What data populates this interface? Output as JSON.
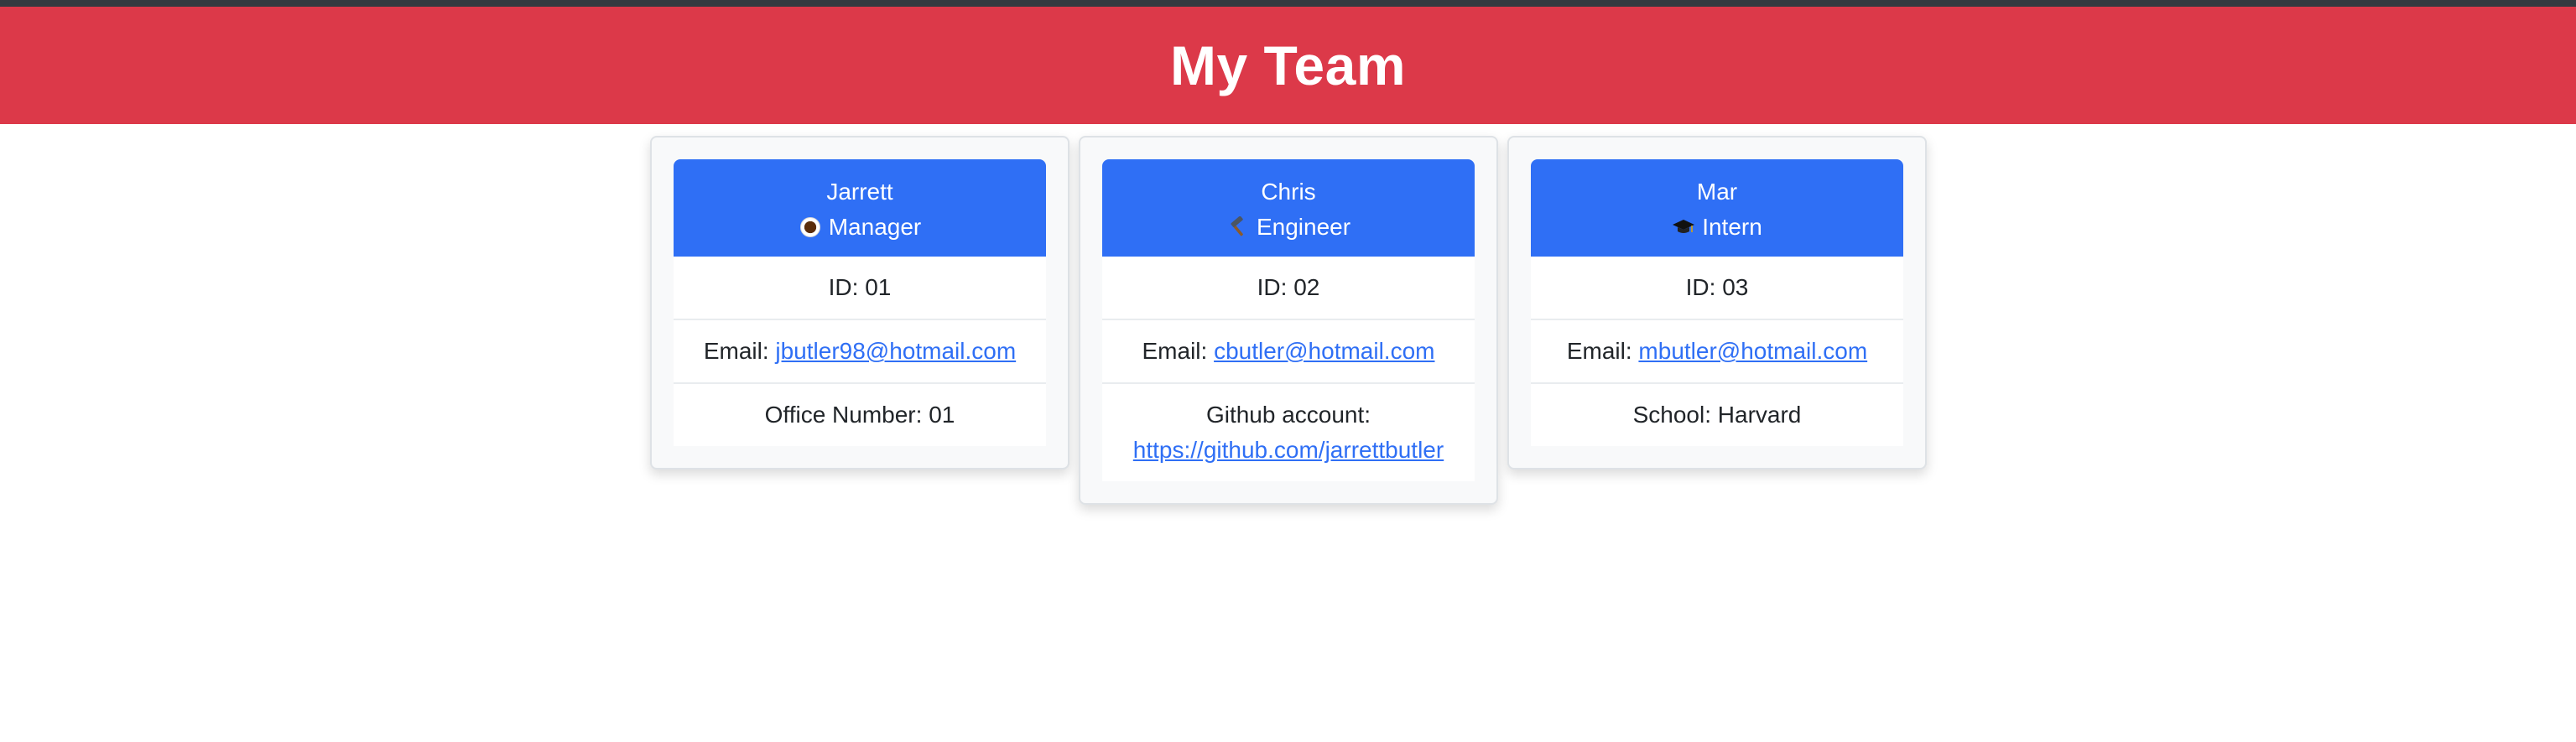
{
  "header": {
    "title": "My Team"
  },
  "team": [
    {
      "name": "Jarrett",
      "role_icon": "coffee-icon",
      "role": "Manager",
      "id": "ID: 01",
      "email_label": "Email: ",
      "email": "jbutler98@hotmail.com",
      "extra_label": "Office Number: 01",
      "extra_link": ""
    },
    {
      "name": "Chris",
      "role_icon": "hammer-icon",
      "role": "Engineer",
      "id": "ID: 02",
      "email_label": "Email: ",
      "email": "cbutler@hotmail.com",
      "extra_label": "Github account:",
      "extra_link": "https://github.com/jarrettbutler"
    },
    {
      "name": "Mar",
      "role_icon": "graduation-cap-icon",
      "role": "Intern",
      "id": "ID: 03",
      "email_label": "Email: ",
      "email": "mbutler@hotmail.com",
      "extra_label": "School: Harvard",
      "extra_link": ""
    }
  ],
  "colors": {
    "banner": "#dc3949",
    "card_header": "#2f6ff5",
    "link": "#2f6ff5"
  }
}
